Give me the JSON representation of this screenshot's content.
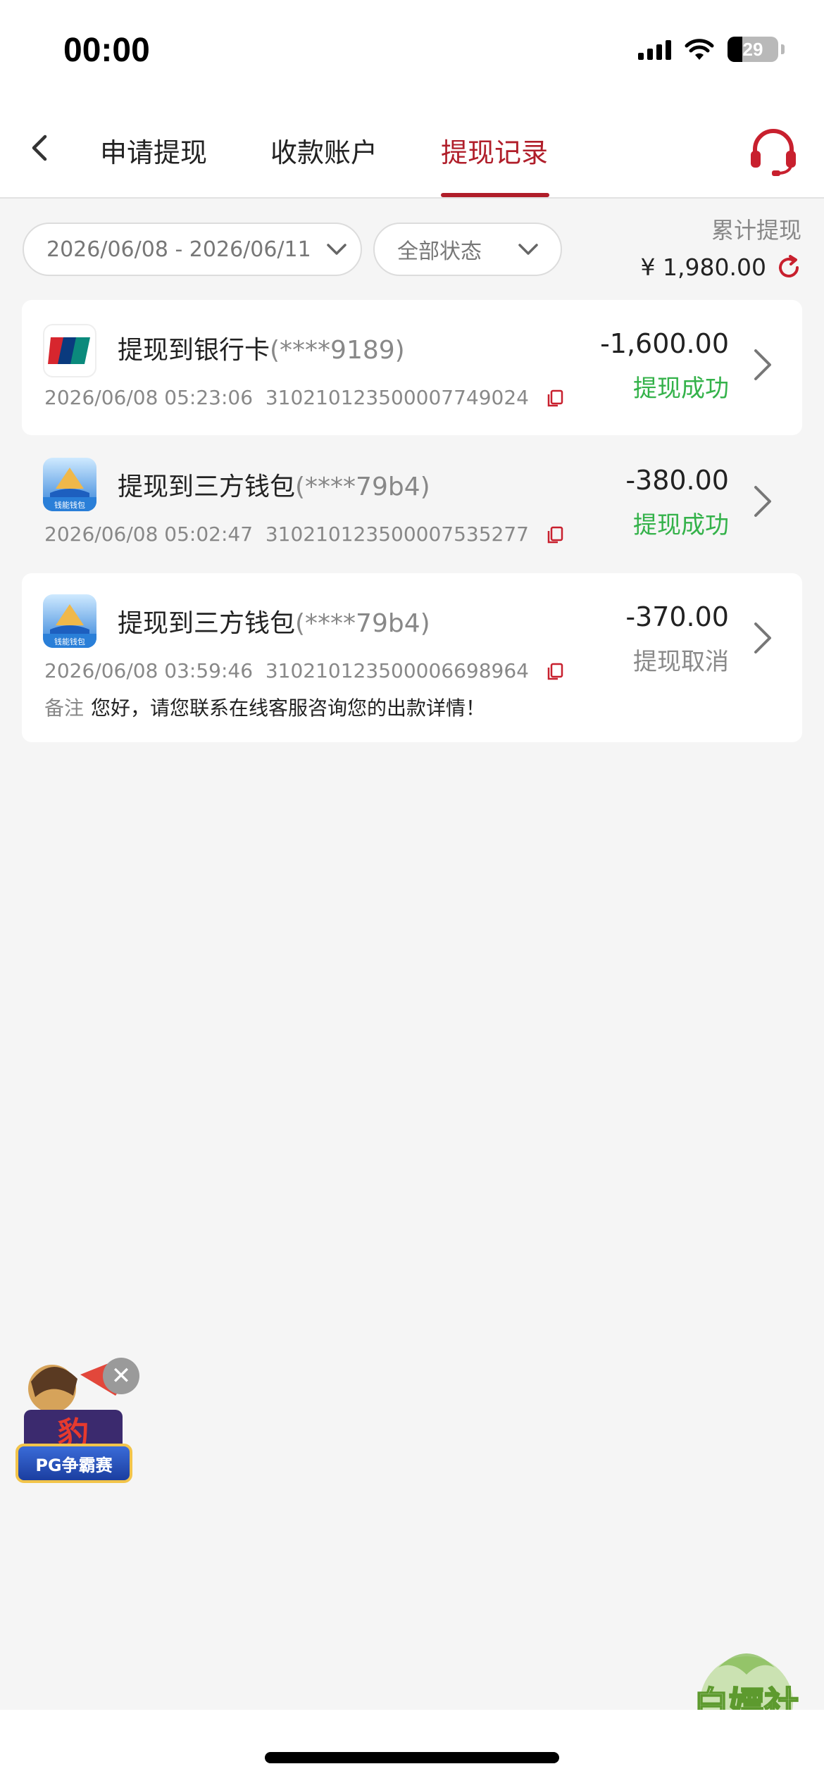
{
  "status_bar": {
    "time": "00:00",
    "battery": "29"
  },
  "nav": {
    "tabs": [
      {
        "label": "申请提现"
      },
      {
        "label": "收款账户"
      },
      {
        "label": "提现记录"
      }
    ]
  },
  "filters": {
    "date_range": "2026/06/08 - 2026/06/11",
    "status": "全部状态"
  },
  "summary": {
    "total_label": "累计提现",
    "total_amount": "¥ 1,980.00"
  },
  "records": [
    {
      "title": "提现到银行卡",
      "account": "(****9189)",
      "datetime": "2026/06/08 05:23:06",
      "order_id": "310210123500007749024",
      "amount": "-1,600.00",
      "status": "提现成功",
      "icon": "unionpay-logo"
    },
    {
      "title": "提现到三方钱包",
      "account": "(****79b4)",
      "datetime": "2026/06/08 05:02:47",
      "order_id": "310210123500007535277",
      "amount": "-380.00",
      "status": "提现成功",
      "icon": "wallet-app-icon",
      "icon_caption": "钱能钱包"
    },
    {
      "title": "提现到三方钱包",
      "account": "(****79b4)",
      "datetime": "2026/06/08 03:59:46",
      "order_id": "310210123500006698964",
      "amount": "-370.00",
      "status": "提现取消",
      "icon": "wallet-app-icon",
      "icon_caption": "钱能钱包",
      "note_label": "备注",
      "note_text": "您好，请您联系在线客服咨询您的出款详情！"
    }
  ],
  "promo": {
    "label": "PG争霸赛"
  },
  "watermark": {
    "text": "白嫖社"
  },
  "colors": {
    "accent": "#b01e2a",
    "success": "#34b24a",
    "muted": "#888888"
  }
}
